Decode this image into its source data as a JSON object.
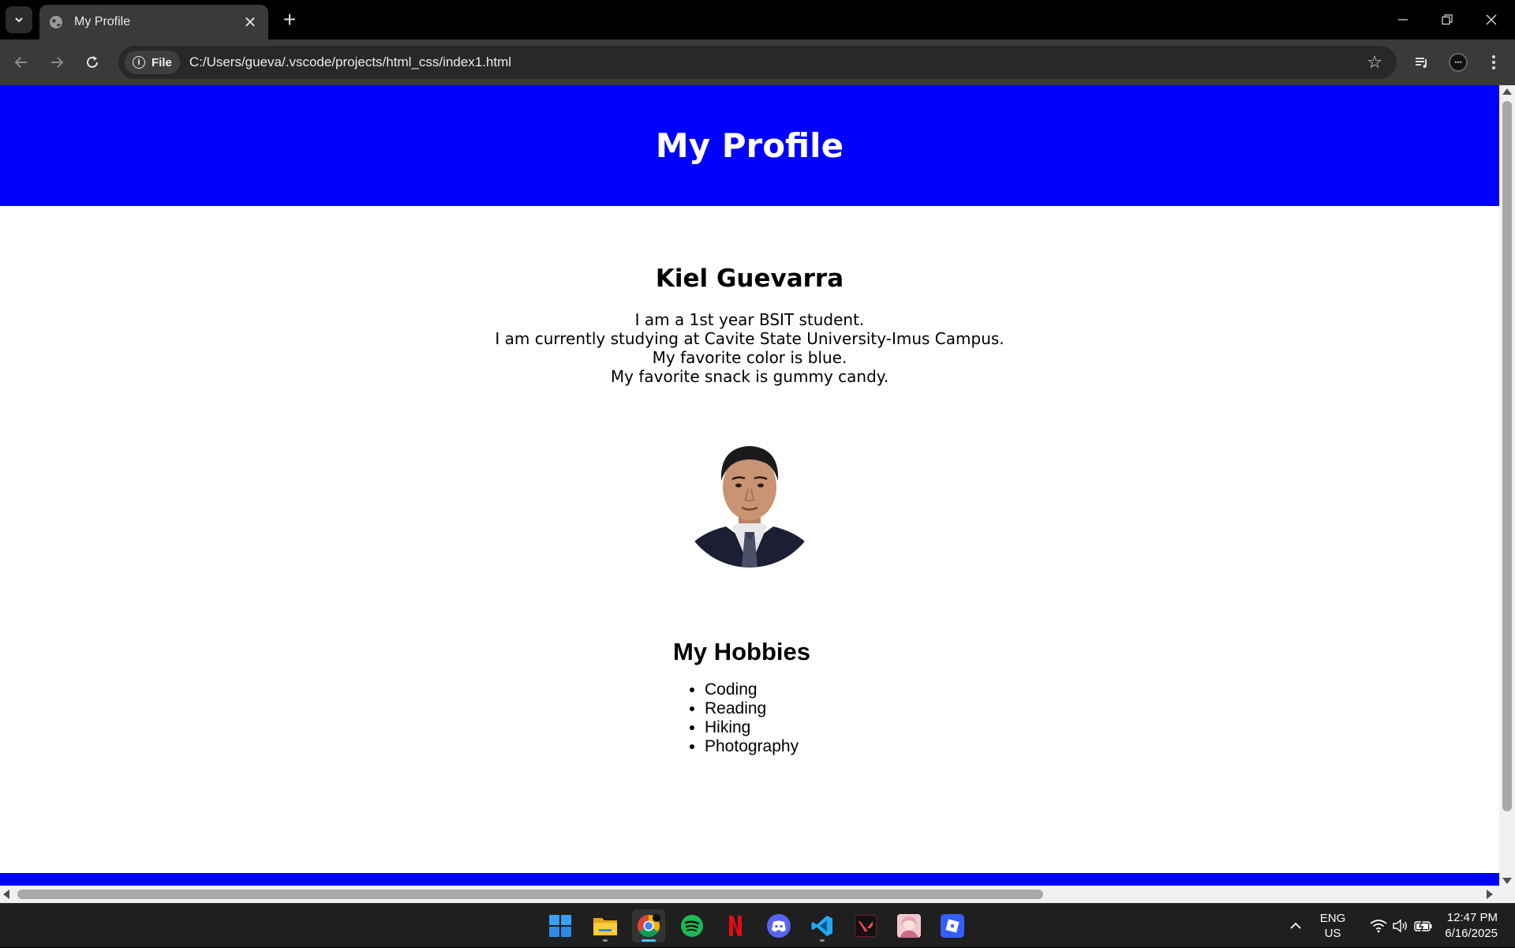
{
  "browser": {
    "tab_title": "My Profile",
    "address_chip": "File",
    "url": "C:/Users/gueva/.vscode/projects/html_css/index1.html"
  },
  "page": {
    "header_title": "My Profile",
    "name": "Kiel Guevarra",
    "bio": [
      "I am a 1st year BSIT student.",
      "I am currently studying at Cavite State University-Imus Campus.",
      "My favorite color is blue.",
      "My favorite snack is gummy candy."
    ],
    "hobbies_title": "My Hobbies",
    "hobbies": [
      "Coding",
      "Reading",
      "Hiking",
      "Photography"
    ],
    "header_color": "#0000ff"
  },
  "taskbar": {
    "apps": [
      "start-icon",
      "file-explorer-icon",
      "chrome-icon",
      "spotify-icon",
      "netflix-icon",
      "discord-icon",
      "vscode-icon",
      "valorant-icon",
      "anime-app-icon",
      "roblox-icon"
    ],
    "lang_line1": "ENG",
    "lang_line2": "US",
    "time": "12:47 PM",
    "date": "6/16/2025"
  }
}
